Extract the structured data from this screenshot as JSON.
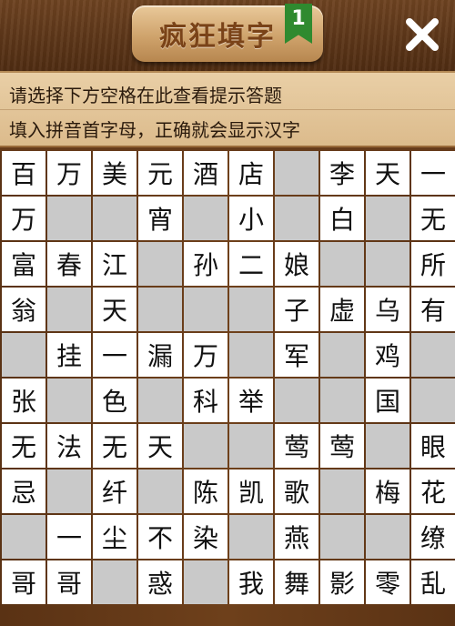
{
  "header": {
    "title": "疯狂填字",
    "level": "1",
    "close_icon": "close-icon"
  },
  "hints": {
    "line1": "请选择下方空格在此查看提示答题",
    "line2": "填入拼音首字母，正确就会显示汉字"
  },
  "board": {
    "rows": [
      [
        "百",
        "万",
        "美",
        "元",
        "酒",
        "店",
        "",
        "李",
        "天",
        "一"
      ],
      [
        "万",
        "",
        "",
        "宵",
        "",
        "小",
        "",
        "白",
        "",
        "无"
      ],
      [
        "富",
        "春",
        "江",
        "",
        "孙",
        "二",
        "娘",
        "",
        "",
        "所"
      ],
      [
        "翁",
        "",
        "天",
        "",
        "",
        "",
        "子",
        "虚",
        "乌",
        "有"
      ],
      [
        "",
        "挂",
        "一",
        "漏",
        "万",
        "",
        "军",
        "",
        "鸡",
        ""
      ],
      [
        "张",
        "",
        "色",
        "",
        "科",
        "举",
        "",
        "",
        "国",
        ""
      ],
      [
        "无",
        "法",
        "无",
        "天",
        "",
        "",
        "莺",
        "莺",
        "",
        "眼"
      ],
      [
        "忌",
        "",
        "纤",
        "",
        "陈",
        "凯",
        "歌",
        "",
        "梅",
        "花"
      ],
      [
        "",
        "一",
        "尘",
        "不",
        "染",
        "",
        "燕",
        "",
        "",
        "缭"
      ],
      [
        "哥",
        "哥",
        "",
        "惑",
        "",
        "我",
        "舞",
        "影",
        "零",
        "乱"
      ]
    ],
    "blank_cells": [
      [
        0,
        6
      ],
      [
        1,
        1
      ],
      [
        1,
        2
      ],
      [
        1,
        4
      ],
      [
        1,
        6
      ],
      [
        1,
        8
      ],
      [
        2,
        3
      ],
      [
        2,
        7
      ],
      [
        2,
        8
      ],
      [
        3,
        1
      ],
      [
        3,
        3
      ],
      [
        3,
        4
      ],
      [
        3,
        5
      ],
      [
        4,
        0
      ],
      [
        4,
        5
      ],
      [
        4,
        7
      ],
      [
        4,
        9
      ],
      [
        5,
        1
      ],
      [
        5,
        3
      ],
      [
        5,
        6
      ],
      [
        5,
        7
      ],
      [
        5,
        9
      ],
      [
        6,
        4
      ],
      [
        6,
        5
      ],
      [
        6,
        8
      ],
      [
        7,
        1
      ],
      [
        7,
        3
      ],
      [
        7,
        7
      ],
      [
        8,
        0
      ],
      [
        8,
        5
      ],
      [
        8,
        7
      ],
      [
        8,
        8
      ],
      [
        9,
        2
      ],
      [
        9,
        4
      ]
    ]
  }
}
